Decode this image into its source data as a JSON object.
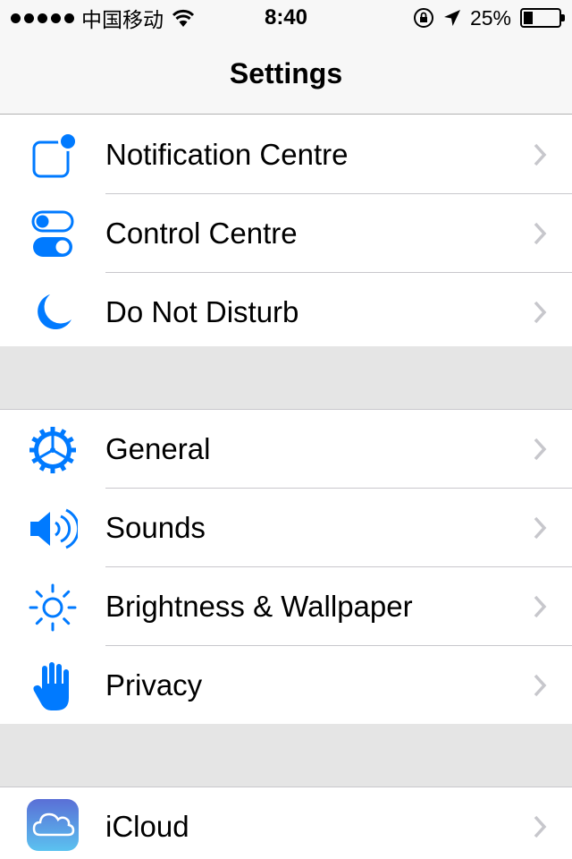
{
  "status_bar": {
    "carrier": "中国移动",
    "time": "8:40",
    "battery_percent": "25%",
    "battery_level": 0.25
  },
  "nav": {
    "title": "Settings"
  },
  "groups": [
    {
      "items": [
        {
          "label": "Notification Centre",
          "icon": "notification-centre-icon"
        },
        {
          "label": "Control Centre",
          "icon": "control-centre-icon"
        },
        {
          "label": "Do Not Disturb",
          "icon": "moon-icon"
        }
      ]
    },
    {
      "items": [
        {
          "label": "General",
          "icon": "gear-icon"
        },
        {
          "label": "Sounds",
          "icon": "speaker-icon"
        },
        {
          "label": "Brightness & Wallpaper",
          "icon": "sun-icon"
        },
        {
          "label": "Privacy",
          "icon": "hand-icon"
        }
      ]
    },
    {
      "items": [
        {
          "label": "iCloud",
          "icon": "cloud-icon"
        }
      ]
    }
  ],
  "colors": {
    "accent": "#007aff",
    "chevron": "#c7c7cc",
    "separator": "#c8c7cc",
    "group_gap": "#e5e5e5"
  }
}
